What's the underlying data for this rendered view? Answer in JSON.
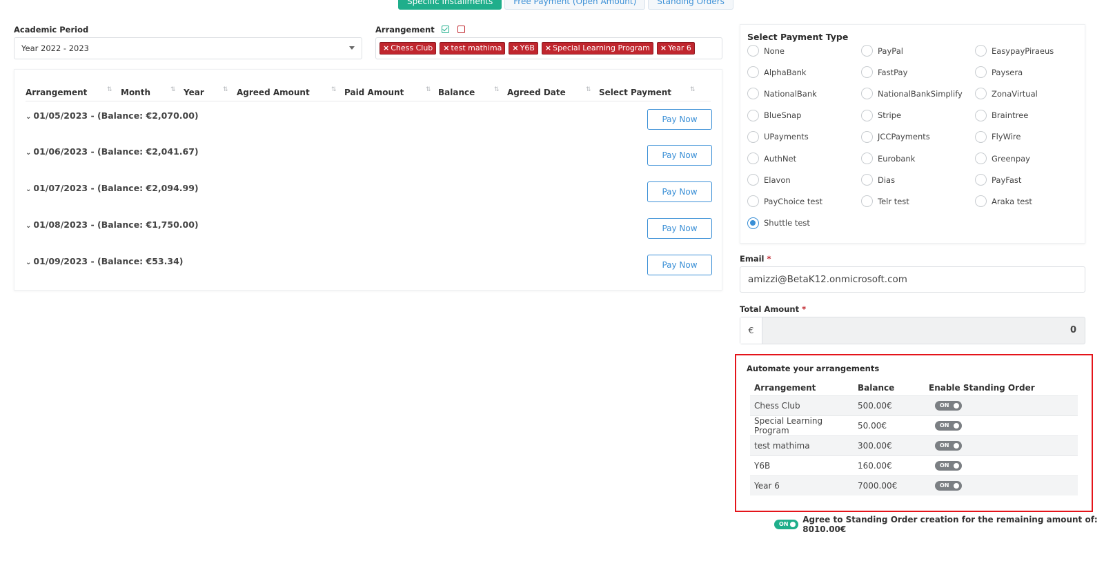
{
  "tabs": [
    {
      "label": "Specific Installments",
      "active": true
    },
    {
      "label": "Free Payment (Open Amount)",
      "active": false
    },
    {
      "label": "Standing Orders",
      "active": false
    }
  ],
  "filters": {
    "academic_period_label": "Academic Period",
    "academic_period_value": "Year 2022 - 2023",
    "arrangement_label": "Arrangement",
    "arrangement_tags": [
      "Chess Club",
      "test mathima",
      "Y6B",
      "Special Learning Program",
      "Year 6"
    ]
  },
  "installments": {
    "columns": [
      "Arrangement",
      "Month",
      "Year",
      "Agreed Amount",
      "Paid Amount",
      "Balance",
      "Agreed Date",
      "Select Payment"
    ],
    "rows": [
      {
        "label": "01/05/2023 - (Balance: €2,070.00)",
        "button": "Pay Now"
      },
      {
        "label": "01/06/2023 - (Balance: €2,041.67)",
        "button": "Pay Now"
      },
      {
        "label": "01/07/2023 - (Balance: €2,094.99)",
        "button": "Pay Now"
      },
      {
        "label": "01/08/2023 - (Balance: €1,750.00)",
        "button": "Pay Now"
      },
      {
        "label": "01/09/2023 - (Balance: €53.34)",
        "button": "Pay Now"
      }
    ]
  },
  "payment_type": {
    "title": "Select Payment Type",
    "options": [
      [
        "None",
        "PayPal",
        "EasypayPiraeus"
      ],
      [
        "AlphaBank",
        "FastPay",
        "Paysera"
      ],
      [
        "NationalBank",
        "NationalBankSimplify",
        "ZonaVirtual"
      ],
      [
        "BlueSnap",
        "Stripe",
        "Braintree"
      ],
      [
        "UPayments",
        "JCCPayments",
        "FlyWire"
      ],
      [
        "AuthNet",
        "Eurobank",
        "Greenpay"
      ],
      [
        "Elavon",
        "Dias",
        "PayFast"
      ],
      [
        "PayChoice test",
        "Telr test",
        "Araka test"
      ],
      [
        "Shuttle test"
      ]
    ],
    "selected": "Shuttle test"
  },
  "email": {
    "label": "Email",
    "required_mark": "*",
    "value": "amizzi@BetaK12.onmicrosoft.com"
  },
  "total": {
    "label": "Total Amount",
    "required_mark": "*",
    "currency": "€",
    "value": "0"
  },
  "automate": {
    "title": "Automate your arrangements",
    "columns": [
      "Arrangement",
      "Balance",
      "Enable Standing Order"
    ],
    "rows": [
      {
        "arrangement": "Chess Club",
        "balance": "500.00€",
        "toggle": "ON"
      },
      {
        "arrangement": "Special Learning Program",
        "balance": "50.00€",
        "toggle": "ON"
      },
      {
        "arrangement": "test mathima",
        "balance": "300.00€",
        "toggle": "ON"
      },
      {
        "arrangement": "Y6B",
        "balance": "160.00€",
        "toggle": "ON"
      },
      {
        "arrangement": "Year 6",
        "balance": "7000.00€",
        "toggle": "ON"
      }
    ]
  },
  "agree": {
    "toggle": "ON",
    "text": "Agree to Standing Order creation for the remaining amount of: 8010.00€"
  },
  "colors": {
    "accent": "#1fae8b",
    "link": "#3a8fd6",
    "tag": "#c0262e",
    "highlight": "#e4141a"
  }
}
